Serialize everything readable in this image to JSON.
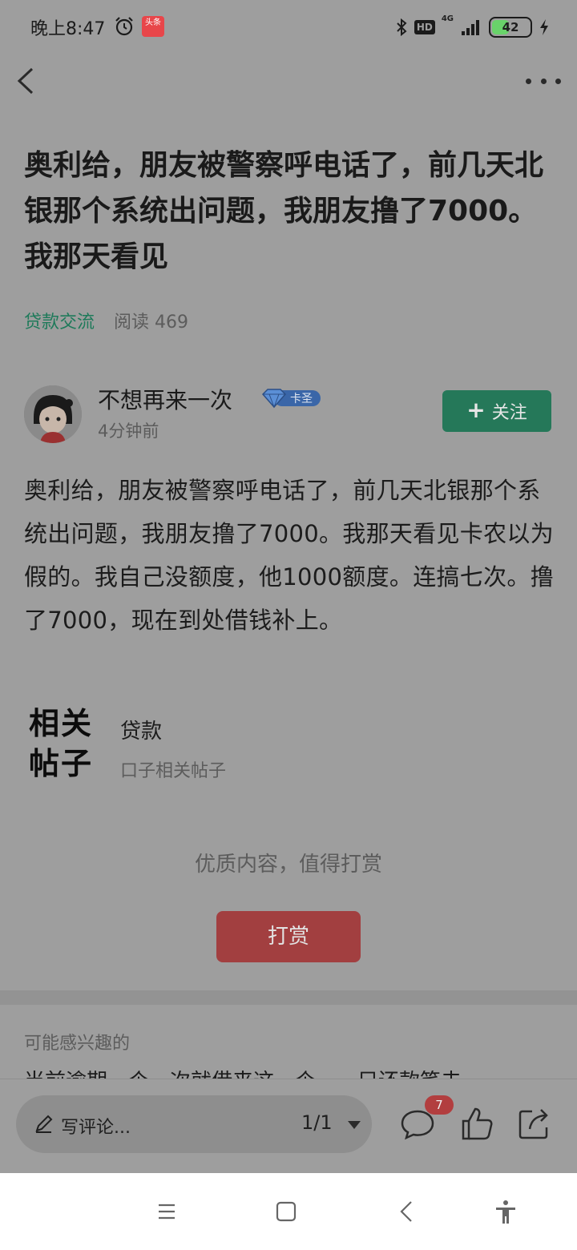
{
  "status": {
    "time": "晚上8:47",
    "app_icon_text": "头条",
    "hd": "HD",
    "network": "4G",
    "battery": "42",
    "battery_level": 0.42
  },
  "article": {
    "title": "奥利给，朋友被警察呼电话了，前几天北银那个系统出问题，我朋友撸了7000。我那天看见",
    "category": "贷款交流",
    "reads": "阅读 469"
  },
  "author": {
    "name": "不想再来一次",
    "badge": "卡圣",
    "time": "4分钟前",
    "follow_label": "关注",
    "follow_icon": "+"
  },
  "body": "奥利给，朋友被警察呼电话了，前几天北银那个系统出问题，我朋友撸了7000。我那天看见卡农以为假的。我自己没额度，他1000额度。连搞七次。撸了7000，现在到处借钱补上。",
  "related": {
    "logo_line1": "相关",
    "logo_line2": "帖子",
    "title": "贷款",
    "subtitle": "口子相关帖子"
  },
  "reward": {
    "prompt": "优质内容，值得打赏",
    "button": "打赏"
  },
  "recommend": {
    "header": "可能感兴趣的",
    "peek": "当前逾期一个，次就借来这一个……只还款笔去"
  },
  "bottom_bar": {
    "comment_placeholder": "写评论...",
    "page_indicator": "1/1",
    "comment_count": "7"
  },
  "colors": {
    "accent_green": "#257859",
    "category_green": "#1e7a5a",
    "reward_red": "#a23f40",
    "overlay_gray": "#9e9e9e"
  },
  "icons": [
    "alarm-icon",
    "bluetooth-icon",
    "signal-icon",
    "charging-icon",
    "back-icon",
    "more-icon",
    "pen-icon",
    "comment-icon",
    "like-icon",
    "share-icon",
    "menu-icon",
    "home-icon",
    "sys-back-icon",
    "accessibility-icon"
  ]
}
